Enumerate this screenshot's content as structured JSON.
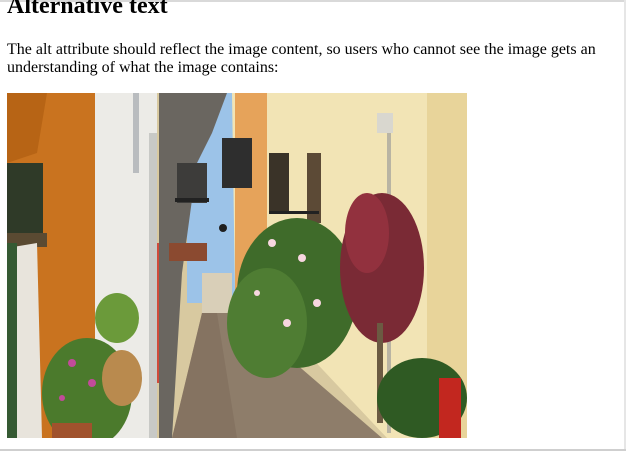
{
  "heading": "Alternative text",
  "paragraph": "The alt attribute should reflect the image content, so users who cannot see the image gets an understanding of what the image contains:",
  "image": {
    "alt": "Narrow cobblestone alley between old colorful houses with flowering plants",
    "colors": {
      "sky": "#9cc3e8",
      "orange_wall": "#c9731f",
      "cream_wall": "#f2e4b5",
      "white_wall": "#ecebe7",
      "cobblestone": "#8e7d6a",
      "foliage": "#3f6b2a",
      "red_leaves": "#7a2a35"
    }
  }
}
